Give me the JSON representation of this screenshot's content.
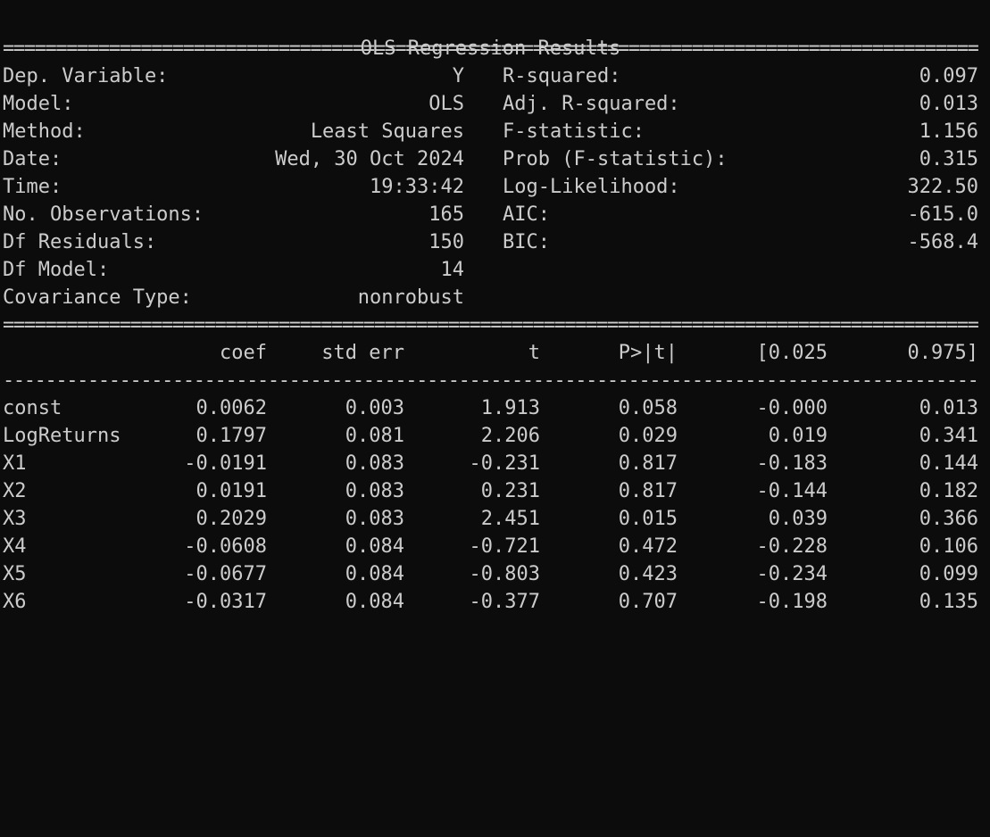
{
  "title": "OLS Regression Results",
  "separator_double": "===========================================================================================================",
  "separator_single": "-----------------------------------------------------------------------------------------------------------",
  "summary": [
    {
      "left_label": "Dep. Variable:",
      "left_value": "Y",
      "right_label": "R-squared:",
      "right_value": "0.097"
    },
    {
      "left_label": "Model:",
      "left_value": "OLS",
      "right_label": "Adj. R-squared:",
      "right_value": "0.013"
    },
    {
      "left_label": "Method:",
      "left_value": "Least Squares",
      "right_label": "F-statistic:",
      "right_value": "1.156"
    },
    {
      "left_label": "Date:",
      "left_value": "Wed, 30 Oct 2024",
      "right_label": "Prob (F-statistic):",
      "right_value": "0.315"
    },
    {
      "left_label": "Time:",
      "left_value": "19:33:42",
      "right_label": "Log-Likelihood:",
      "right_value": "322.50"
    },
    {
      "left_label": "No. Observations:",
      "left_value": "165",
      "right_label": "AIC:",
      "right_value": "-615.0"
    },
    {
      "left_label": "Df Residuals:",
      "left_value": "150",
      "right_label": "BIC:",
      "right_value": "-568.4"
    },
    {
      "left_label": "Df Model:",
      "left_value": "14",
      "right_label": "",
      "right_value": ""
    },
    {
      "left_label": "Covariance Type:",
      "left_value": "nonrobust",
      "right_label": "",
      "right_value": ""
    }
  ],
  "coef_headers": [
    "coef",
    "std err",
    "t",
    "P>|t|",
    "[0.025",
    "0.975]"
  ],
  "coef_rows": [
    {
      "name": "const",
      "values": [
        "0.0062",
        "0.003",
        "1.913",
        "0.058",
        "-0.000",
        "0.013"
      ]
    },
    {
      "name": "LogReturns",
      "values": [
        "0.1797",
        "0.081",
        "2.206",
        "0.029",
        "0.019",
        "0.341"
      ]
    },
    {
      "name": "X1",
      "values": [
        "-0.0191",
        "0.083",
        "-0.231",
        "0.817",
        "-0.183",
        "0.144"
      ]
    },
    {
      "name": "X2",
      "values": [
        "0.0191",
        "0.083",
        "0.231",
        "0.817",
        "-0.144",
        "0.182"
      ]
    },
    {
      "name": "X3",
      "values": [
        "0.2029",
        "0.083",
        "2.451",
        "0.015",
        "0.039",
        "0.366"
      ]
    },
    {
      "name": "X4",
      "values": [
        "-0.0608",
        "0.084",
        "-0.721",
        "0.472",
        "-0.228",
        "0.106"
      ]
    },
    {
      "name": "X5",
      "values": [
        "-0.0677",
        "0.084",
        "-0.803",
        "0.423",
        "-0.234",
        "0.099"
      ]
    },
    {
      "name": "X6",
      "values": [
        "-0.0317",
        "0.084",
        "-0.377",
        "0.707",
        "-0.198",
        "0.135"
      ]
    }
  ]
}
